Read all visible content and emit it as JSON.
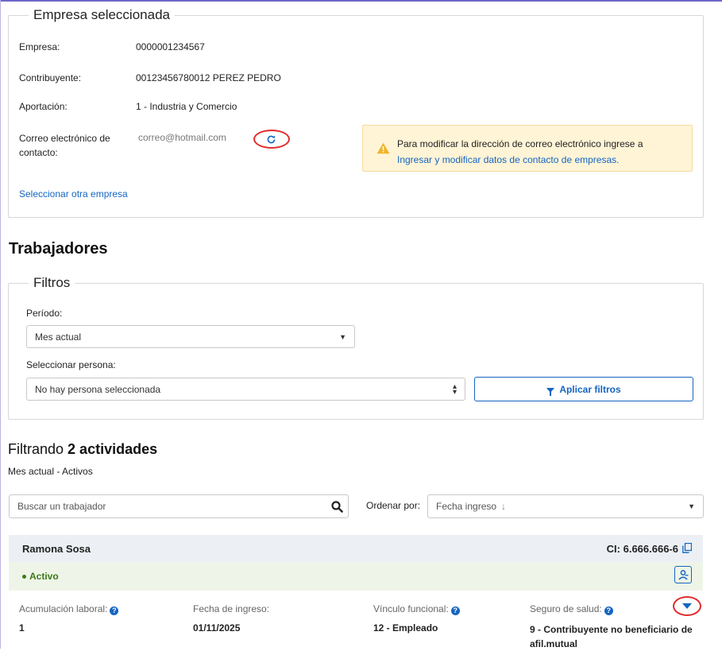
{
  "empresa_box": {
    "legend": "Empresa seleccionada",
    "rows": [
      {
        "label": "Empresa:",
        "value": "0000001234567"
      },
      {
        "label": "Contribuyente:",
        "value": "00123456780012 PEREZ PEDRO"
      },
      {
        "label": "Aportación:",
        "value": "1 - Industria y Comercio"
      }
    ],
    "email_label": "Correo electrónico de contacto:",
    "email_value": "correo@hotmail.com",
    "refresh_icon": "refresh-icon",
    "warning": {
      "text": "Para modificar la dirección de correo electrónico ingrese a",
      "link": "Ingresar y modificar datos de contacto de empresas."
    },
    "select_other_link": "Seleccionar otra empresa"
  },
  "trabajadores": {
    "title": "Trabajadores",
    "filters": {
      "legend": "Filtros",
      "period_label": "Período:",
      "period_value": "Mes actual",
      "person_label": "Seleccionar persona:",
      "person_value": "No hay persona seleccionada",
      "apply_label": "Aplicar filtros"
    }
  },
  "results": {
    "prefix": "Filtrando",
    "count_text": "2 actividades",
    "subtitle": "Mes actual - Activos",
    "search_placeholder": "Buscar un trabajador",
    "order_label": "Ordenar por:",
    "order_value": "Fecha ingreso",
    "order_arrow": "↓"
  },
  "worker": {
    "name": "Ramona Sosa",
    "ci": "CI: 6.666.666-6",
    "status": "Activo",
    "fields": [
      {
        "label": "Acumulación laboral:",
        "value": "1",
        "help": true
      },
      {
        "label": "Fecha de ingreso:",
        "value": "01/11/2025",
        "help": false
      },
      {
        "label": "Vínculo funcional:",
        "value": "12 - Empleado",
        "help": true
      },
      {
        "label": "Seguro de salud:",
        "value": "9 - Contribuyente no beneficiario de afil.mutual",
        "help": true
      }
    ]
  },
  "colors": {
    "accent": "#1565c0",
    "warning_bg": "#fff4d6",
    "status_green": "#3d7a1a",
    "annotation_red": "#e32b2b"
  }
}
